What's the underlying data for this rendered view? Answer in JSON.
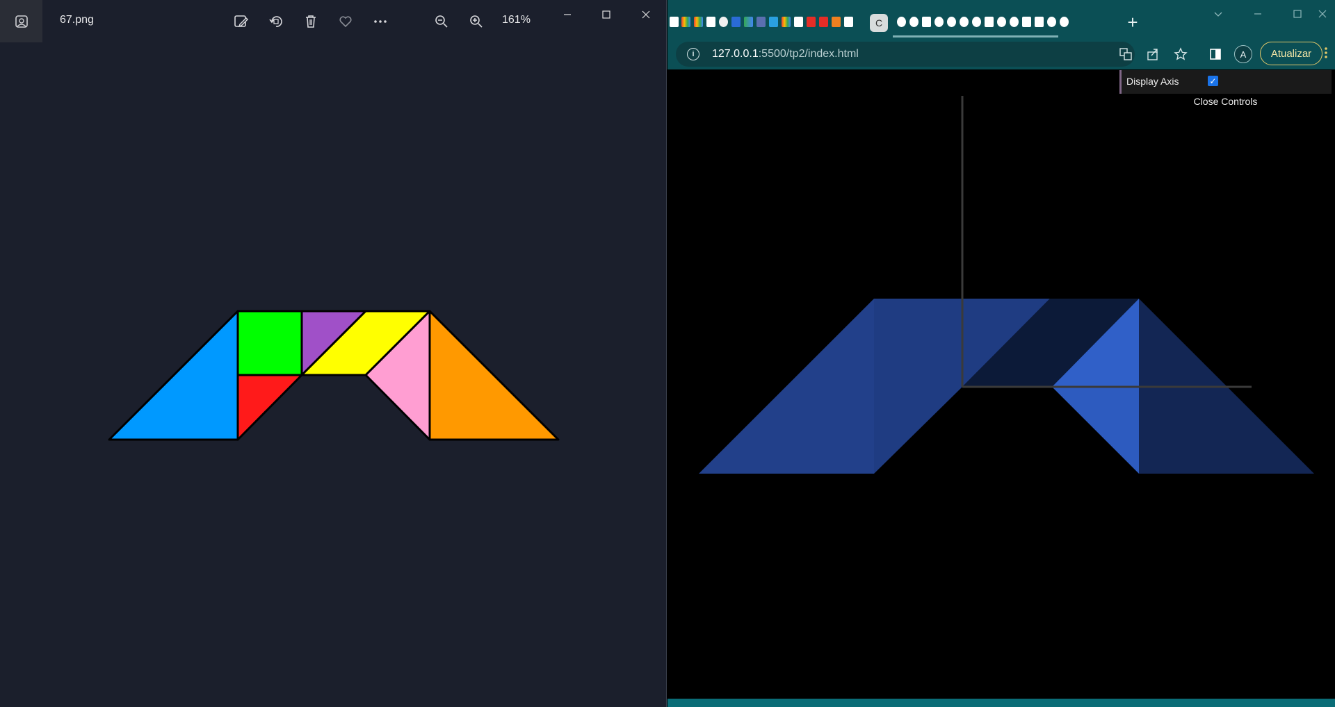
{
  "photos": {
    "file_name": "67.png",
    "zoom_level": "161%",
    "toolbar_icons": [
      "edit-image-icon",
      "rotate-icon",
      "delete-icon",
      "favorite-icon",
      "more-icon",
      "zoom-out-icon",
      "zoom-in-icon"
    ],
    "tangram_colors": {
      "blue": "#0099ff",
      "green": "#00ff00",
      "red": "#ff1a1a",
      "purple": "#a050c8",
      "yellow": "#ffff00",
      "pink": "#ff9ed2",
      "orange": "#ff9900",
      "outline": "#000000"
    }
  },
  "browser": {
    "active_tab_label": "C",
    "url_host": "127.0.0.1",
    "url_rest": ":5500/tp2/index.html",
    "avatar_letter": "A",
    "update_label": "Atualizar",
    "gui": {
      "display_axis_label": "Display Axis",
      "display_axis_checked": true,
      "close_controls_label": "Close Controls"
    },
    "scene_colors": {
      "front": "#22408a",
      "dark": "#0c1a38",
      "bright": "#3060c8",
      "axis": "#3a3a3a"
    }
  }
}
